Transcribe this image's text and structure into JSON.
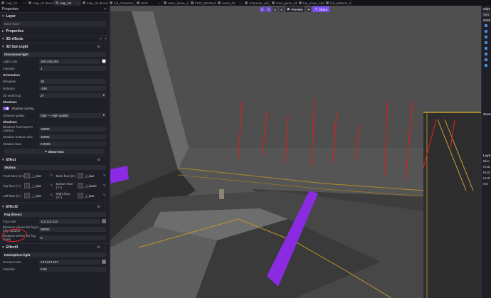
{
  "tabs": [
    {
      "label": "map_01",
      "active": false
    },
    {
      "label": "map_01 (Events)",
      "active": false
    },
    {
      "label": "map_02",
      "active": true
    },
    {
      "label": "map_02 (Events)",
      "active": false
    },
    {
      "label": "full_character_...",
      "active": false
    },
    {
      "label": "HUD",
      "active": false
    },
    {
      "label": "enter_leave_m...",
      "active": false
    },
    {
      "label": "FOR_DEVELOPER",
      "active": false
    },
    {
      "label": "notes_01",
      "active": false
    },
    {
      "label": "character_aid_...",
      "active": false
    },
    {
      "label": "start_game_01",
      "active": false
    },
    {
      "label": "top_down_cam...",
      "active": false
    },
    {
      "label": "fall_platform_01",
      "active": false
    }
  ],
  "left_panel": {
    "title": "Properties",
    "layer_section": "Layer",
    "layer_name": "Base layer",
    "properties_section": "Properties",
    "effects_section": "3D effects",
    "sun_light": {
      "header": "3D Sun Light",
      "light_type": "Directional light",
      "light_color_label": "Light color",
      "light_color_value": "255;255;255",
      "intensity_label": "Intensity",
      "intensity_value": "1",
      "orientation_label": "Orientation",
      "elevation_label": "Elevation",
      "elevation_value": "30",
      "rotation_label": "Rotation",
      "rotation_value": "-290",
      "world_top_label": "3D world top",
      "world_top_value": "Z+",
      "shadows_label": "Shadows",
      "shadow_casting_label": "Shadow casting",
      "shadow_quality_label": "Shadow quality",
      "shadow_quality_value": "high — High quality",
      "shadows_label2": "Shadows",
      "distance_camera_label": "Distance from layer's camera",
      "distance_camera_value": "10000",
      "frustum_label": "Shadow frustum size",
      "frustum_value": "10000",
      "bias_label": "Shadow bias",
      "bias_value": "0.0005",
      "show_less_label": "Show less"
    },
    "skybox": {
      "header": "Effect",
      "type": "Skybox",
      "faces": [
        {
          "label": "Front face (Z+)",
          "value": "_/_/aor"
        },
        {
          "label": "Back face (Z-)",
          "value": "_/_/aor"
        },
        {
          "label": "Top face (Y-)",
          "value": "_/_/aor"
        },
        {
          "label": "Bottom face (Y+)",
          "value": "_/_/amsi"
        },
        {
          "label": "Left face (X-)",
          "value": "_/_/aor"
        },
        {
          "label": "Right face (X+)",
          "value": "_/_/aor"
        }
      ]
    },
    "fog": {
      "header": "Effect2",
      "type": "Fog (linear)",
      "color_label": "Fog color",
      "color_value": "114;114;114",
      "opaque_label": "Distance where the fog is fully opaque",
      "opaque_value": "90000",
      "starts_label": "Distance where the fog starts",
      "starts_value": "0"
    },
    "hemisphere": {
      "header": "Effect3",
      "type": "Hemisphere light",
      "ground_label": "Ground color",
      "ground_value": "127;127;127",
      "intensity_label": "Intensity",
      "intensity_value": "0.05"
    }
  },
  "viewport": {
    "preview_label": "Preview",
    "share_label": "Share"
  },
  "right_panel": {
    "objects_label": "Obje",
    "global_label": "Glob",
    "search_label": "Sea",
    "scene_label": "Scen",
    "layers_label": "Laye",
    "items": [
      "Bloc",
      "HUD",
      "HUD",
      "HUD",
      "visi"
    ]
  },
  "colors": {
    "accent": "#7c4ff0",
    "annotation_red": "#e02828",
    "panel_bg": "#1f1f27"
  }
}
